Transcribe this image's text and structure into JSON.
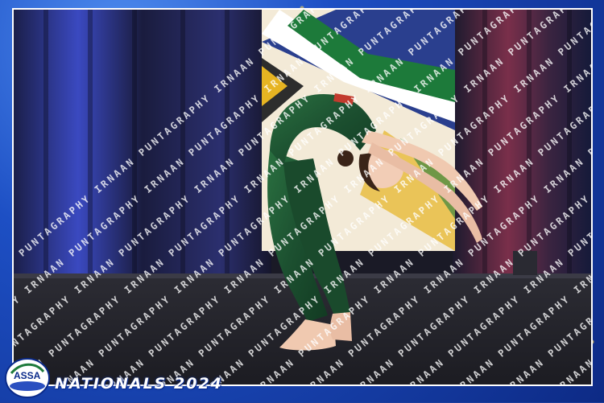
{
  "watermark": {
    "text": "IRNAAN PUNTAGRAPHY"
  },
  "branding": {
    "logo_text": "ASSA",
    "event_title": "NATIONALS 2024"
  },
  "colors": {
    "frame_blue": "#1d4fc4",
    "costume_green": "#1f5a32",
    "stage_floor": "#2a2a30"
  }
}
